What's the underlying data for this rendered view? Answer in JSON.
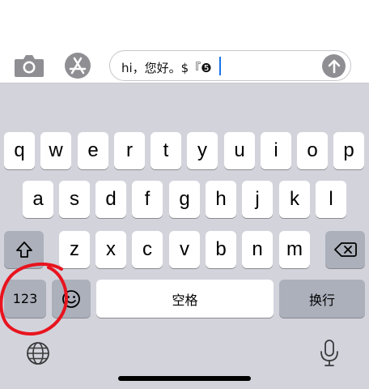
{
  "toolbar": {
    "camera_icon": "camera-icon",
    "appstore_icon": "app-store-icon"
  },
  "message": {
    "text": "hi，您好。$『❺",
    "send_icon": "arrow-up-icon"
  },
  "keyboard": {
    "row1": [
      "q",
      "w",
      "e",
      "r",
      "t",
      "y",
      "u",
      "i",
      "o",
      "p"
    ],
    "row2": [
      "a",
      "s",
      "d",
      "f",
      "g",
      "h",
      "j",
      "k",
      "l"
    ],
    "row3": [
      "z",
      "x",
      "c",
      "v",
      "b",
      "n",
      "m"
    ],
    "numbers_key": "123",
    "space_key": "空格",
    "return_key": "换行",
    "shift_icon": "shift-icon",
    "delete_icon": "delete-icon",
    "emoji_icon": "emoji-icon",
    "globe_icon": "globe-icon",
    "mic_icon": "microphone-icon"
  },
  "annotation": {
    "color": "#e8141e"
  },
  "colors": {
    "key_light": "#ffffff",
    "key_dark": "#abb0bb",
    "keyboard_bg": "#d3d3dc",
    "caret": "#1a73e8"
  }
}
